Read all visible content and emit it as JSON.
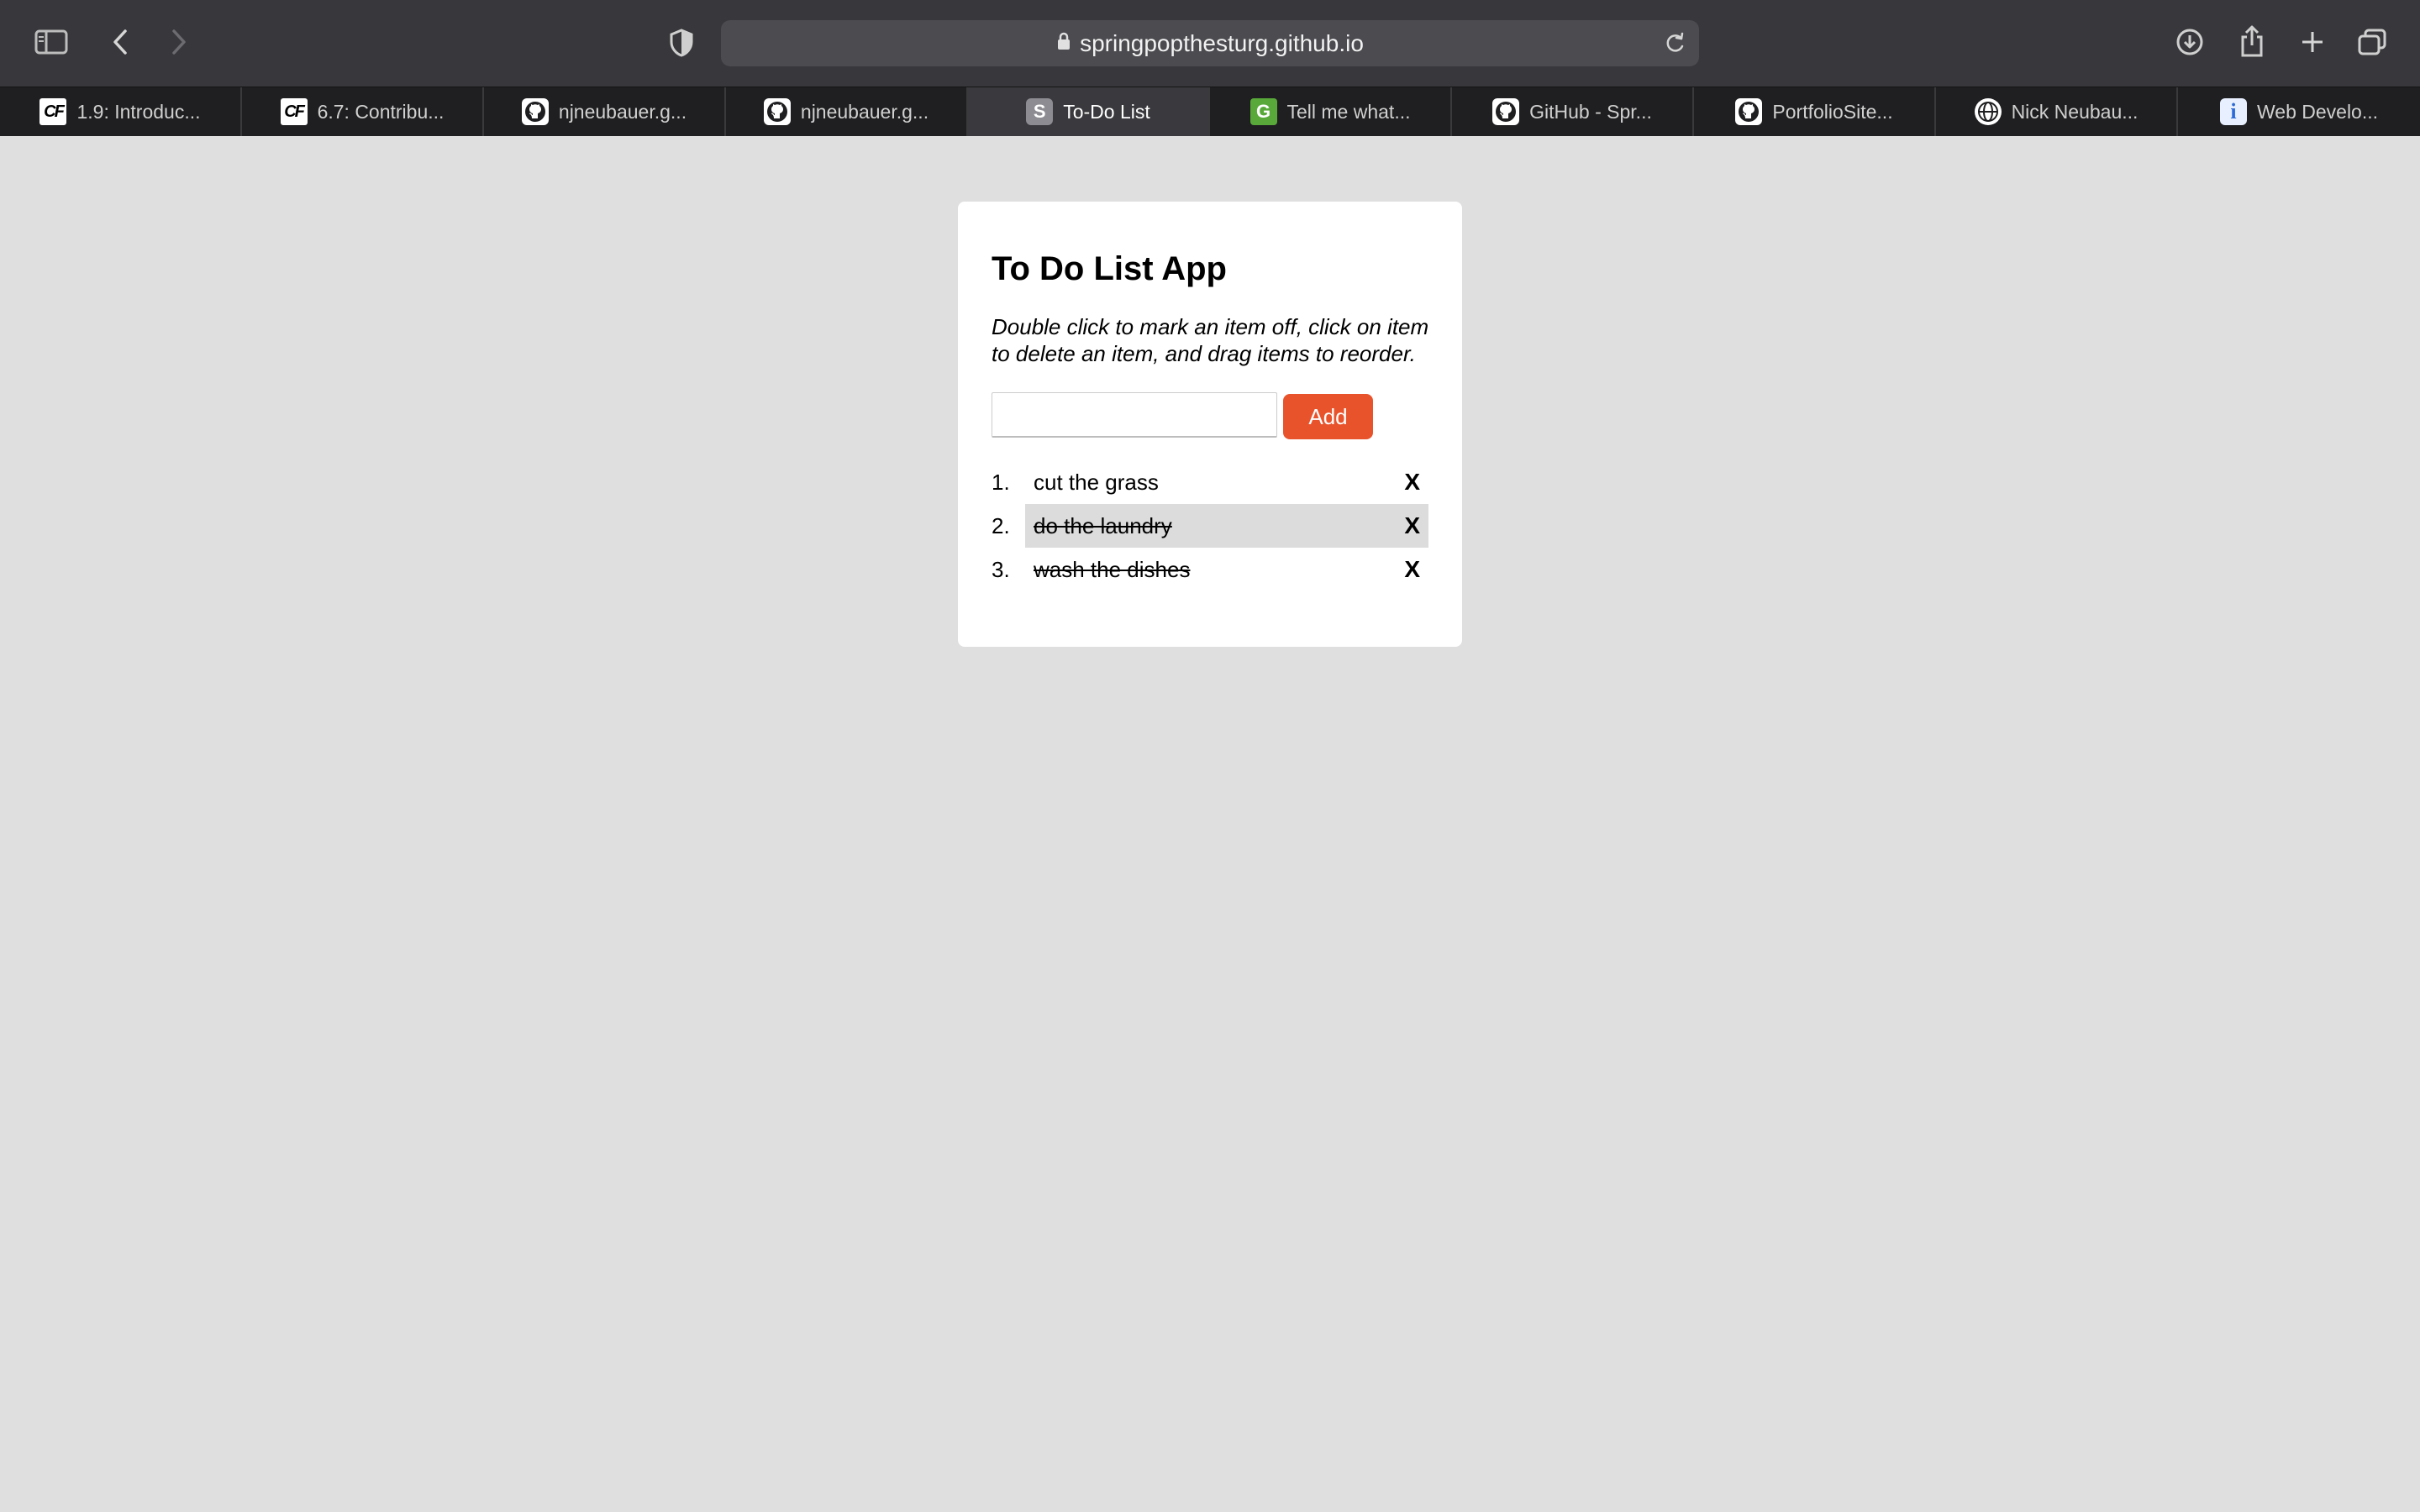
{
  "browser": {
    "url": "springpopthesturg.github.io",
    "tabs": [
      {
        "title": "1.9: Introduc...",
        "favicon": "cf-logo-icon",
        "active": false
      },
      {
        "title": "6.7: Contribu...",
        "favicon": "cf-logo-icon",
        "active": false
      },
      {
        "title": "njneubauer.g...",
        "favicon": "github-icon",
        "active": false
      },
      {
        "title": "njneubauer.g...",
        "favicon": "github-icon",
        "active": false
      },
      {
        "title": "To-Do List",
        "favicon": "s-letter-icon",
        "active": true
      },
      {
        "title": "Tell me what...",
        "favicon": "g-letter-icon",
        "active": false
      },
      {
        "title": "GitHub - Spr...",
        "favicon": "github-icon",
        "active": false
      },
      {
        "title": "PortfolioSite...",
        "favicon": "github-icon",
        "active": false
      },
      {
        "title": "Nick Neubau...",
        "favicon": "globe-icon",
        "active": false
      },
      {
        "title": "Web Develo...",
        "favicon": "info-icon",
        "active": false
      }
    ],
    "favicon_letters": {
      "cf": "CF",
      "s": "S",
      "g": "G",
      "i": "i"
    }
  },
  "app": {
    "title": "To Do List App",
    "instructions": "Double click to mark an item off, click on item to delete an item, and drag items to reorder.",
    "input_value": "",
    "add_label": "Add",
    "delete_label": "X",
    "items": [
      {
        "number": "1.",
        "text": "cut the grass",
        "done": false
      },
      {
        "number": "2.",
        "text": "do the laundry",
        "done": true
      },
      {
        "number": "3.",
        "text": "wash the dishes",
        "done": true
      }
    ]
  },
  "colors": {
    "accent": "#e8532b",
    "page_background": "#dfdfdf",
    "toolbar": "#38383c"
  }
}
